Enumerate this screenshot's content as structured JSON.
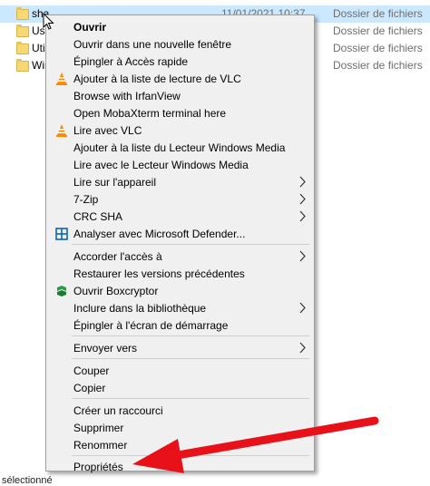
{
  "files": [
    {
      "name": "sha",
      "date": "11/01/2021 10:37",
      "type": "Dossier de fichiers",
      "selected": true
    },
    {
      "name": "Use",
      "date": "",
      "type": "Dossier de fichiers",
      "selected": false
    },
    {
      "name": "Util",
      "date": "",
      "type": "Dossier de fichiers",
      "selected": false
    },
    {
      "name": "Win",
      "date": "",
      "type": "Dossier de fichiers",
      "selected": false
    }
  ],
  "status": {
    "selection_text": "sélectionné"
  },
  "context_menu": {
    "items": {
      "open": "Ouvrir",
      "open_new_window": "Ouvrir dans une nouvelle fenêtre",
      "pin_quick_access": "Épingler à Accès rapide",
      "vlc_add_playlist": "Ajouter à la liste de lecture de VLC",
      "browse_irfanview": "Browse with IrfanView",
      "open_mobaxterm": "Open MobaXterm terminal here",
      "play_vlc": "Lire avec VLC",
      "wmp_add_list": "Ajouter à la liste du Lecteur Windows Media",
      "wmp_play": "Lire avec le Lecteur Windows Media",
      "play_on_device": "Lire sur l'appareil",
      "seven_zip": "7-Zip",
      "crc_sha": "CRC SHA",
      "defender_scan": "Analyser avec Microsoft Defender...",
      "give_access": "Accorder l'accès à",
      "restore_versions": "Restaurer les versions précédentes",
      "open_boxcryptor": "Ouvrir Boxcryptor",
      "include_library": "Inclure dans la bibliothèque",
      "pin_start": "Épingler à l'écran de démarrage",
      "send_to": "Envoyer vers",
      "cut": "Couper",
      "copy": "Copier",
      "create_shortcut": "Créer un raccourci",
      "delete": "Supprimer",
      "rename": "Renommer",
      "properties": "Propriétés"
    }
  },
  "colors": {
    "selection": "#cce8ff",
    "menu_bg": "#f0f0f0",
    "arrow_red": "#e8111a",
    "vlc_orange": "#ff8800",
    "defender_blue": "#0a64b4",
    "boxcryptor_green": "#2e9a4a"
  },
  "icons": {
    "vlc": "vlc-cone-icon",
    "defender": "defender-shield-icon",
    "boxcryptor": "boxcryptor-icon",
    "folder": "folder-icon",
    "submenu": "chevron-right-icon"
  }
}
